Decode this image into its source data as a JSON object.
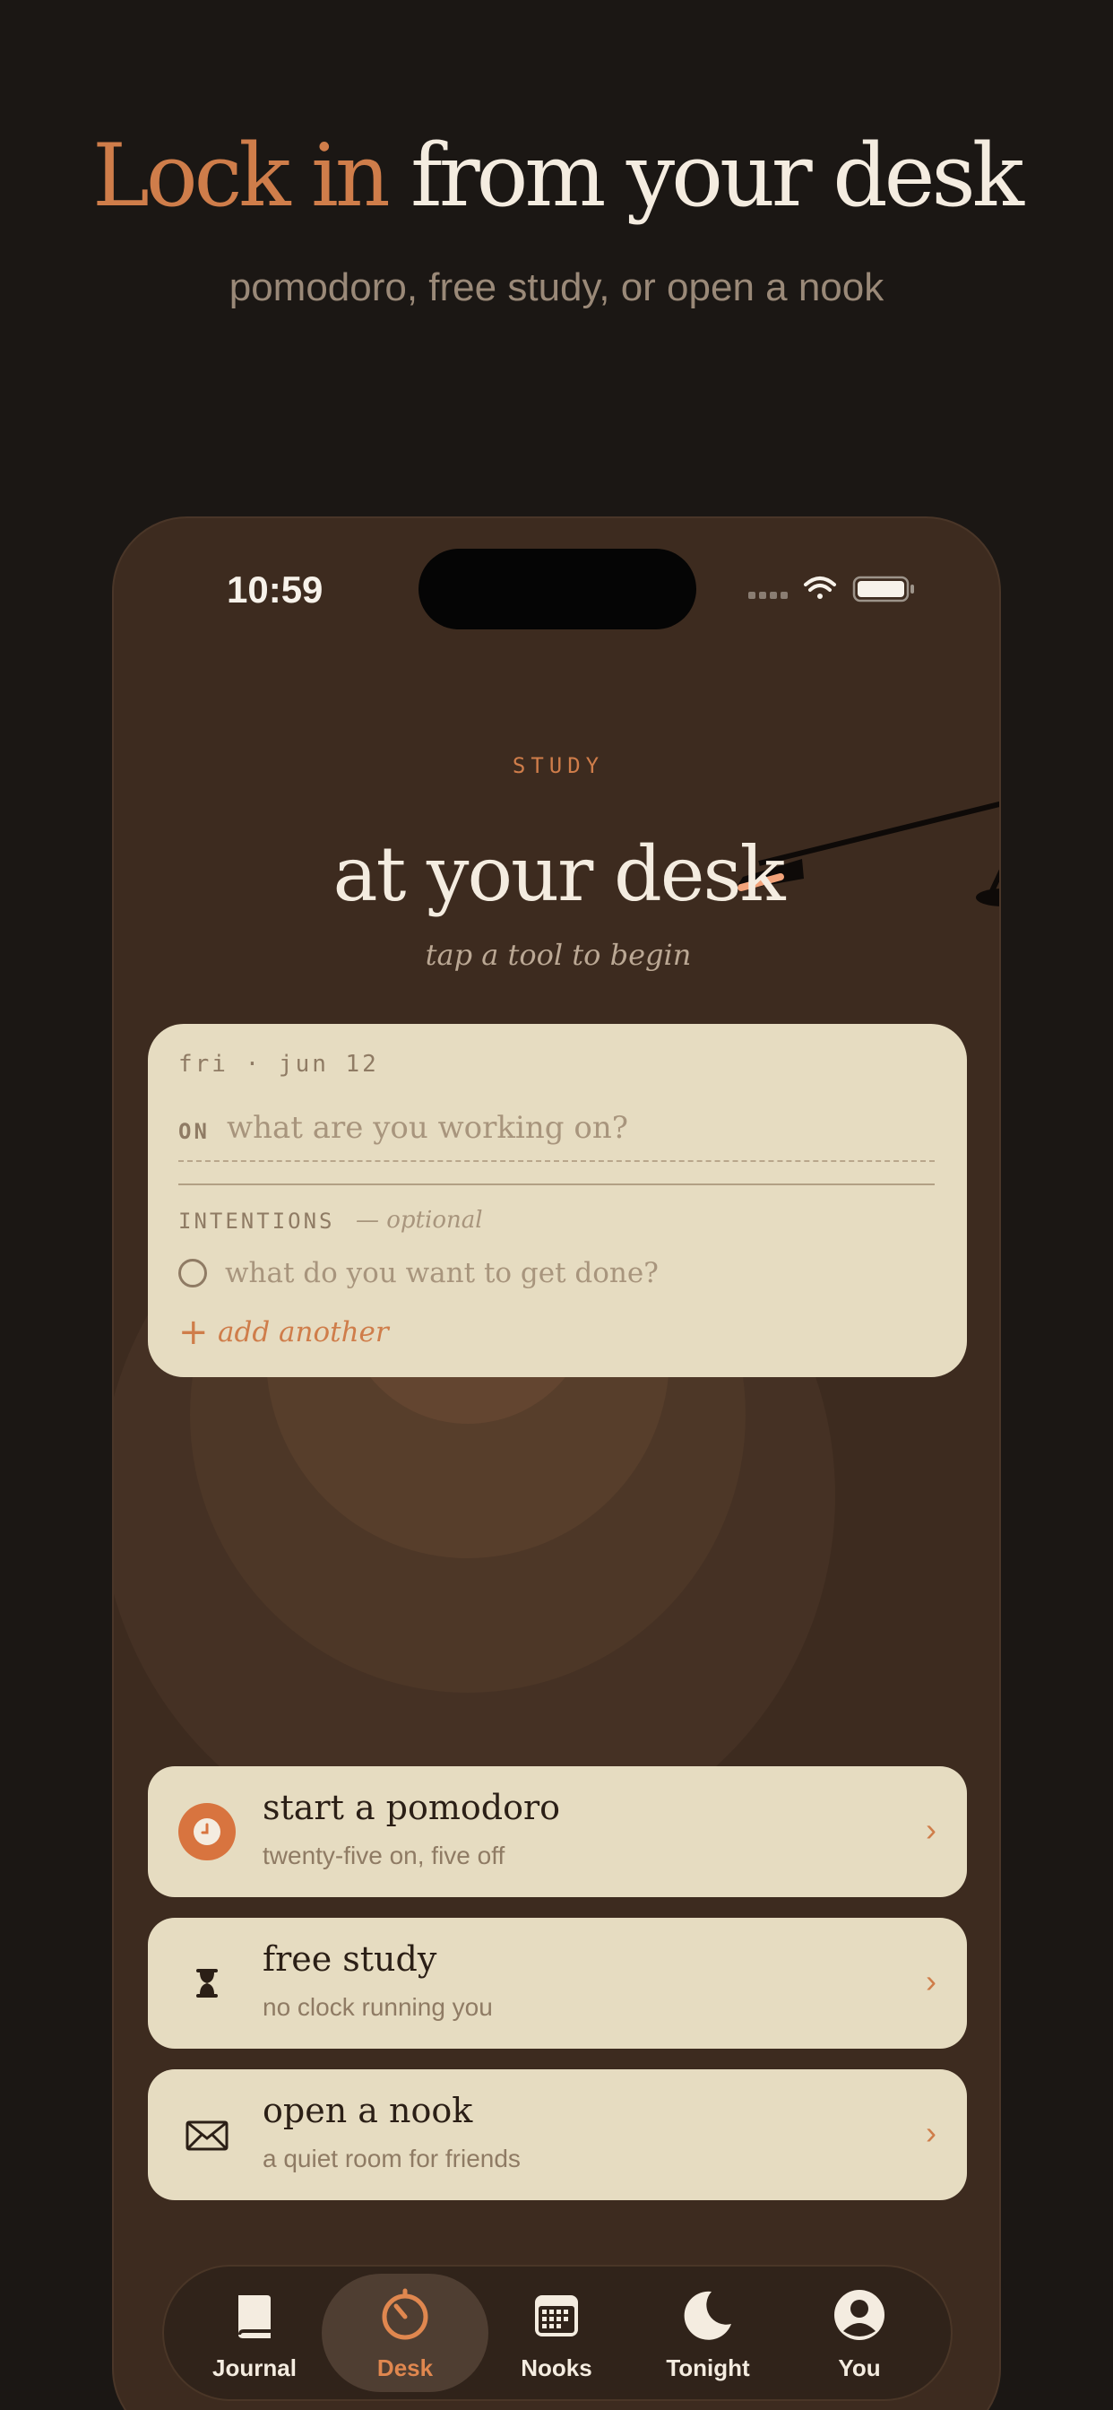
{
  "marketing": {
    "headline_accent": "Lock in",
    "headline_rest": "from your desk",
    "subheadline": "pomodoro, free study, or open a nook"
  },
  "status_bar": {
    "time": "10:59",
    "icons": [
      "signal-icon",
      "wifi-icon",
      "battery-icon"
    ]
  },
  "screen": {
    "eyebrow": "STUDY",
    "title": "at your desk",
    "subtitle": "tap a tool to begin"
  },
  "session_card": {
    "date": "fri · jun 12",
    "on_label": "ON",
    "on_value": "",
    "on_placeholder": "what are you working on?",
    "intentions_label": "INTENTIONS",
    "intentions_optional": "— optional",
    "intention_value": "",
    "intention_placeholder": "what do you want to get done?",
    "add_another": "add another"
  },
  "tools": [
    {
      "title": "start a pomodoro",
      "subtitle": "twenty-five on, five off",
      "icon": "clock-icon",
      "chevron": "›"
    },
    {
      "title": "free study",
      "subtitle": "no clock running you",
      "icon": "hourglass-icon",
      "chevron": "›"
    },
    {
      "title": "open a nook",
      "subtitle": "a quiet room for friends",
      "icon": "envelope-icon",
      "chevron": "›"
    }
  ],
  "tab_bar": {
    "active": "Desk",
    "items": [
      {
        "label": "Journal",
        "icon": "book-icon"
      },
      {
        "label": "Desk",
        "icon": "timer-icon"
      },
      {
        "label": "Nooks",
        "icon": "calendar-icon"
      },
      {
        "label": "Tonight",
        "icon": "moon-icon"
      },
      {
        "label": "You",
        "icon": "person-icon"
      }
    ]
  },
  "colors": {
    "background": "#1b1714",
    "phone": "#3d2b1f",
    "card": "#e6dcc1",
    "accent": "#cf7d4a",
    "text_light": "#f4ece0"
  }
}
